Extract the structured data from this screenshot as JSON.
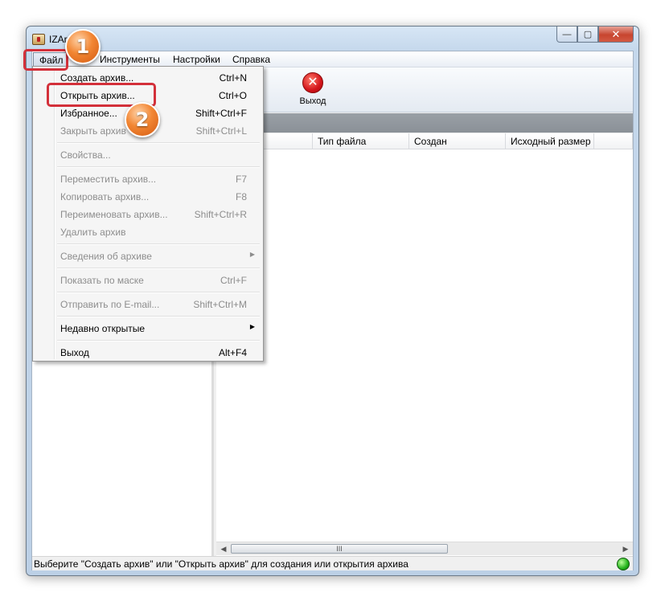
{
  "window": {
    "title": "IZAr",
    "minimize_glyph": "—",
    "maximize_glyph": "▢",
    "close_glyph": "✕"
  },
  "menubar": {
    "file": "Файл",
    "tools": "Инструменты",
    "settings": "Настройки",
    "help": "Справка"
  },
  "toolbar": {
    "exit_label": "Выход",
    "exit_glyph": "✕"
  },
  "columns": [
    "Тип файла",
    "Создан",
    "Исходный размер"
  ],
  "file_menu": {
    "items": [
      {
        "label": "Создать архив...",
        "shortcut": "Ctrl+N",
        "enabled": true
      },
      {
        "label": "Открыть архив...",
        "shortcut": "Ctrl+O",
        "enabled": true
      },
      {
        "label": "Избранное...",
        "shortcut": "Shift+Ctrl+F",
        "enabled": true
      },
      {
        "label": "Закрыть архив",
        "shortcut": "Shift+Ctrl+L",
        "enabled": false
      },
      {
        "label": "Свойства...",
        "shortcut": "",
        "enabled": false
      },
      {
        "label": "Переместить архив...",
        "shortcut": "F7",
        "enabled": false
      },
      {
        "label": "Копировать архив...",
        "shortcut": "F8",
        "enabled": false
      },
      {
        "label": "Переименовать архив...",
        "shortcut": "Shift+Ctrl+R",
        "enabled": false
      },
      {
        "label": "Удалить архив",
        "shortcut": "",
        "enabled": false
      },
      {
        "label": "Сведения об архиве",
        "shortcut": "",
        "enabled": false,
        "submenu_glyph": "▶"
      },
      {
        "label": "Показать по маске",
        "shortcut": "Ctrl+F",
        "enabled": false
      },
      {
        "label": "Отправить по E-mail...",
        "shortcut": "Shift+Ctrl+M",
        "enabled": false
      },
      {
        "label": "Недавно открытые",
        "shortcut": "",
        "enabled": true,
        "submenu_glyph": "▶"
      },
      {
        "label": "Выход",
        "shortcut": "Alt+F4",
        "enabled": true
      }
    ]
  },
  "scrollbar": {
    "left_arrow": "◀",
    "right_arrow": "▶",
    "grip": "III"
  },
  "statusbar": {
    "text": "Выберите \"Создать архив\" или \"Открыть архив\" для создания или открытия архива"
  },
  "annotations": {
    "step1": "1",
    "step2": "2",
    "highlight_color": "#d3303a",
    "badge_color": "#f28633"
  }
}
